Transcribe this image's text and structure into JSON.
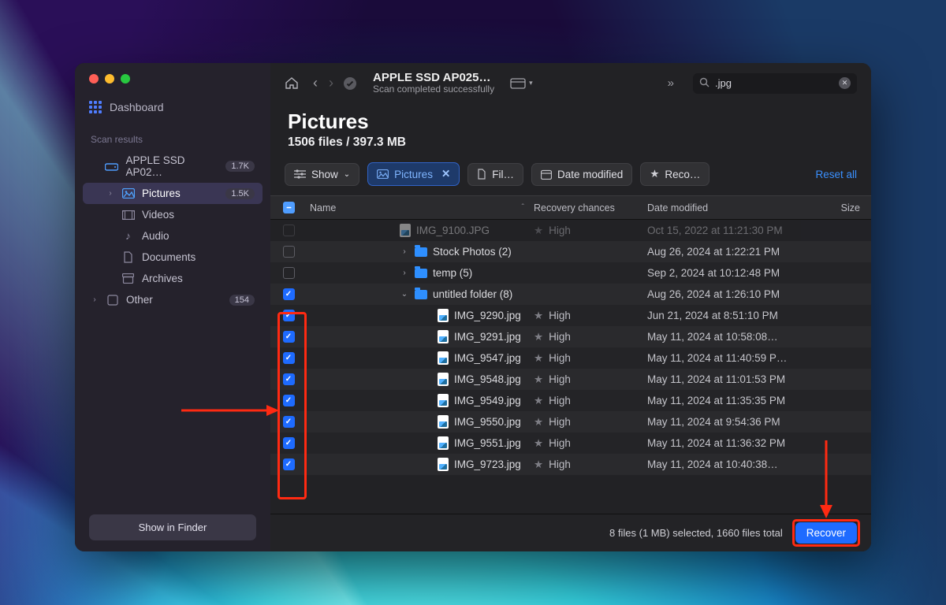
{
  "sidebar": {
    "dashboard": "Dashboard",
    "section_title": "Scan results",
    "disk": {
      "label": "APPLE SSD AP02…",
      "badge": "1.7K"
    },
    "pictures": {
      "label": "Pictures",
      "badge": "1.5K"
    },
    "videos": "Videos",
    "audio": "Audio",
    "documents": "Documents",
    "archives": "Archives",
    "other": {
      "label": "Other",
      "badge": "154"
    },
    "show_in_finder": "Show in Finder"
  },
  "topbar": {
    "title": "APPLE SSD AP025…",
    "subtitle": "Scan completed successfully",
    "search_value": ".jpg"
  },
  "heading": {
    "title": "Pictures",
    "subtitle": "1506 files / 397.3 MB"
  },
  "filters": {
    "show": "Show",
    "pictures": "Pictures",
    "file": "Fil…",
    "date": "Date modified",
    "recovery": "Reco…",
    "reset": "Reset all"
  },
  "columns": {
    "name": "Name",
    "recovery": "Recovery chances",
    "date": "Date modified",
    "size": "Size"
  },
  "rows": [
    {
      "kind": "ghost-file",
      "name": "IMG_9100.JPG",
      "rec": "High",
      "date": "Oct 15, 2022 at 11:21:30 PM",
      "checked": false
    },
    {
      "kind": "folder",
      "name": "Stock Photos (2)",
      "date": "Aug 26, 2024 at 1:22:21 PM",
      "checked": false,
      "disclose": ">"
    },
    {
      "kind": "folder",
      "name": "temp (5)",
      "date": "Sep 2, 2024 at 10:12:48 PM",
      "checked": false,
      "disclose": ">"
    },
    {
      "kind": "folder",
      "name": "untitled folder (8)",
      "date": "Aug 26, 2024 at 1:26:10 PM",
      "checked": true,
      "disclose": "v"
    },
    {
      "kind": "file",
      "name": "IMG_9290.jpg",
      "rec": "High",
      "date": "Jun 21, 2024 at 8:51:10 PM",
      "checked": true
    },
    {
      "kind": "file",
      "name": "IMG_9291.jpg",
      "rec": "High",
      "date": "May 11, 2024 at 10:58:08…",
      "checked": true
    },
    {
      "kind": "file",
      "name": "IMG_9547.jpg",
      "rec": "High",
      "date": "May 11, 2024 at 11:40:59 P…",
      "checked": true
    },
    {
      "kind": "file",
      "name": "IMG_9548.jpg",
      "rec": "High",
      "date": "May 11, 2024 at 11:01:53 PM",
      "checked": true
    },
    {
      "kind": "file",
      "name": "IMG_9549.jpg",
      "rec": "High",
      "date": "May 11, 2024 at 11:35:35 PM",
      "checked": true
    },
    {
      "kind": "file",
      "name": "IMG_9550.jpg",
      "rec": "High",
      "date": "May 11, 2024 at 9:54:36 PM",
      "checked": true
    },
    {
      "kind": "file",
      "name": "IMG_9551.jpg",
      "rec": "High",
      "date": "May 11, 2024 at 11:36:32 PM",
      "checked": true
    },
    {
      "kind": "file",
      "name": "IMG_9723.jpg",
      "rec": "High",
      "date": "May 11, 2024 at 10:40:38…",
      "checked": true
    }
  ],
  "footer": {
    "status": "8 files (1 MB) selected, 1660 files total",
    "recover": "Recover"
  }
}
